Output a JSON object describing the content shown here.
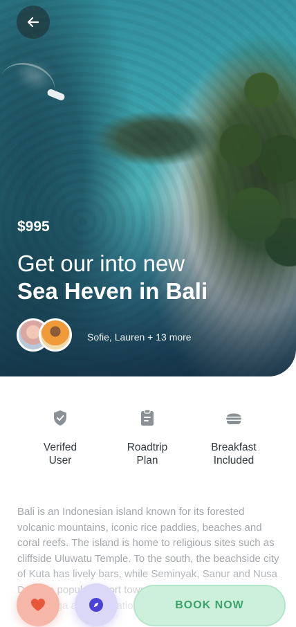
{
  "hero": {
    "price": "$995",
    "title_line1": "Get our into new",
    "title_line2": "Sea Heven in Bali",
    "travelers": "Sofie, Lauren + 13 more"
  },
  "features": [
    {
      "icon": "shield-check-icon",
      "label": "Verifed\nUser"
    },
    {
      "icon": "clipboard-icon",
      "label": "Roadtrip\nPlan"
    },
    {
      "icon": "burger-icon",
      "label": "Breakfast\nIncluded"
    }
  ],
  "description": "Bali is an Indonesian island known for its forested volcanic mountains, iconic rice paddies, beaches and coral reefs. The island is home to religious sites such as cliffside Uluwatu Temple. To the south, the beachside city of Kuta has lively bars, while Seminyak, Sanur and Nusa Dua are popular resort towns. The island is also known for its yoga and meditation retreats.",
  "actions": {
    "book_label": "BOOK NOW"
  },
  "colors": {
    "favorite_bg": "#f6b6a8",
    "favorite_icon": "#e8573a",
    "explore_bg": "#dad8f6",
    "explore_icon": "#4b43d6",
    "book_bg": "#cdf0dc",
    "book_text": "#3ba36a"
  }
}
